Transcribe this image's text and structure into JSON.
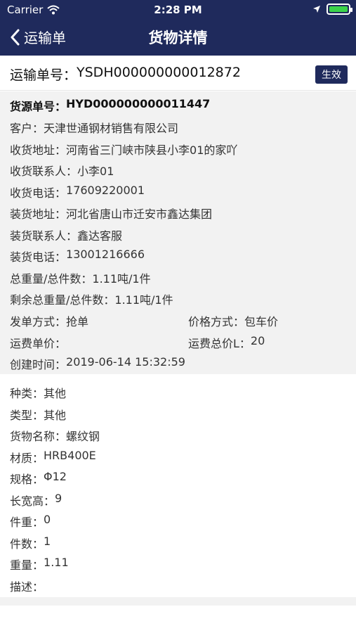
{
  "status_bar": {
    "carrier": "Carrier",
    "time": "2:28 PM"
  },
  "nav": {
    "back_label": "运输单",
    "title": "货物详情"
  },
  "order": {
    "label": "运输单号：",
    "value": "YSDH000000000012872",
    "status": "生效"
  },
  "source": {
    "rows": [
      {
        "label": "货源单号：",
        "value": "HYD000000000011447"
      },
      {
        "label": "客户：",
        "value": "天津世通钢材销售有限公司"
      },
      {
        "label": "收货地址：",
        "value": "河南省三门峡市陕县小李01的家吖"
      },
      {
        "label": "收货联系人：",
        "value": "小李01"
      },
      {
        "label": "收货电话：",
        "value": "17609220001"
      },
      {
        "label": "装货地址：",
        "value": "河北省唐山市迁安市鑫达集团"
      },
      {
        "label": "装货联系人：",
        "value": "鑫达客服"
      },
      {
        "label": "装货电话：",
        "value": "13001216666"
      },
      {
        "label": "总重量/总件数：",
        "value": "1.11吨/1件"
      },
      {
        "label": "剩余总重量/总件数：",
        "value": "1.11吨/1件"
      }
    ],
    "send_method": {
      "label": "发单方式：",
      "value": "抢单"
    },
    "price_method": {
      "label": "价格方式：",
      "value": "包车价"
    },
    "unit_price": {
      "label": "运费单价：",
      "value": ""
    },
    "total_price": {
      "label": "运费总价L：",
      "value": "20"
    },
    "created": {
      "label": "创建时间：",
      "value": "2019-06-14 15:32:59"
    }
  },
  "goods": {
    "rows": [
      {
        "label": "种类：",
        "value": "其他"
      },
      {
        "label": "类型：",
        "value": "其他"
      },
      {
        "label": "货物名称：",
        "value": "螺纹钢"
      },
      {
        "label": "材质：",
        "value": "HRB400E"
      },
      {
        "label": "规格：",
        "value": "Φ12"
      },
      {
        "label": "长宽高：",
        "value": "9"
      },
      {
        "label": "件重：",
        "value": "0"
      },
      {
        "label": "件数：",
        "value": "1"
      },
      {
        "label": "重量：",
        "value": "1.11"
      },
      {
        "label": "描述：",
        "value": ""
      }
    ]
  },
  "icons": {
    "wifi": "wifi-icon",
    "location": "location-arrow-icon",
    "battery": "battery-icon",
    "back": "chevron-left-icon"
  },
  "colors": {
    "header": "#1f2a5c",
    "badge": "#1f2a5c",
    "section_bg": "#f2f2f2",
    "battery": "#3bd34a"
  }
}
